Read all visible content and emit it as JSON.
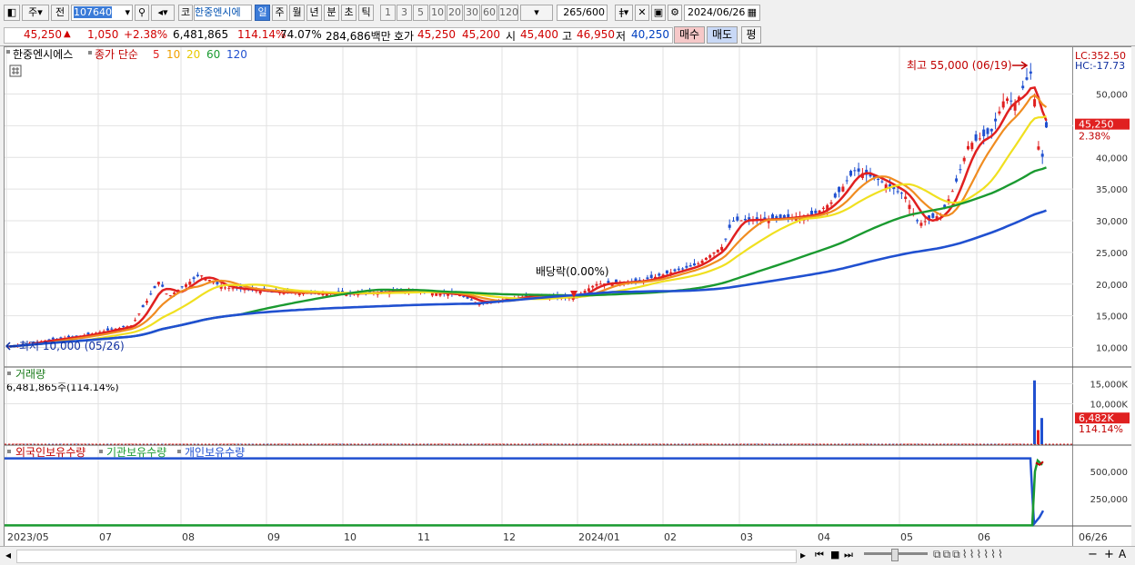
{
  "toolbar": {
    "period_letter": "주",
    "prev_label": "전",
    "code_value": "107640",
    "code_label": "코",
    "stock_name": "한중엔시에",
    "periods": [
      "일",
      "주",
      "월",
      "년",
      "분",
      "초",
      "틱"
    ],
    "selected_period": "일",
    "intervals": [
      "1",
      "3",
      "5",
      "10",
      "20",
      "30",
      "60",
      "120"
    ],
    "count_value": "265",
    "count_total": "/600",
    "date_value": "2024/06/26"
  },
  "quote": {
    "price": "45,250",
    "change_arrow": "▲",
    "change": "1,050",
    "change_pct": "+2.38%",
    "volume": "6,481,865",
    "volume_pct": "114.14%",
    "ratio": "74.07%",
    "amount": "284,686백만",
    "ask_label": "호가",
    "ask": "45,250",
    "bid": "45,200",
    "open_label": "시",
    "open": "45,400",
    "high_label": "고",
    "high": "46,950",
    "low_label": "저",
    "low": "40,250",
    "buy_label": "매수",
    "sell_label": "매도",
    "eval_label": "평"
  },
  "price_panel": {
    "legend_name": "한중엔시에스",
    "legend_type": "종가 단순",
    "ma": [
      {
        "period": "5",
        "color": "#e02020"
      },
      {
        "period": "10",
        "color": "#f0a000"
      },
      {
        "period": "20",
        "color": "#e8c800"
      },
      {
        "period": "60",
        "color": "#1a9a30"
      },
      {
        "period": "120",
        "color": "#2050d0"
      }
    ],
    "max_label": "최고 55,000 (06/19)",
    "min_label": "최저 10,000 (05/26)",
    "dividend_label": "배당락(0.00%)",
    "lc_label": "LC:352.50",
    "hc_label": "HC:-17.73",
    "current_price": "45,250",
    "current_pct": "2.38%",
    "yticks": [
      "50,000",
      "45,000",
      "40,000",
      "35,000",
      "30,000",
      "25,000",
      "20,000",
      "15,000",
      "10,000"
    ]
  },
  "volume_panel": {
    "title": "거래량",
    "value": "6,481,865주(114.14%)",
    "yticks": [
      "15,000K",
      "10,000K"
    ],
    "current": "6,482K",
    "current_pct": "114.14%"
  },
  "holding_panel": {
    "s1": "외국인보유수량",
    "s2": "기관보유수량",
    "s3": "개인보유수량",
    "yticks": [
      "500,000",
      "250,000"
    ]
  },
  "xaxis": {
    "labels": [
      "2023/05",
      "07",
      "08",
      "09",
      "10",
      "11",
      "12",
      "2024/01",
      "02",
      "03",
      "04",
      "05",
      "06"
    ],
    "end_label": "06/26"
  },
  "chart_data": {
    "type": "candlestick",
    "title": "한중엔시에스",
    "x_range": [
      "2023/05/26",
      "2024/06/26"
    ],
    "ylim": [
      8000,
      56000
    ],
    "monthly_close_approx": [
      {
        "x": "2023/05",
        "y": 10500
      },
      {
        "x": "2023/06",
        "y": 11800
      },
      {
        "x": "2023/07",
        "y": 12500
      },
      {
        "x": "2023/08",
        "y": 20000
      },
      {
        "x": "2023/09",
        "y": 18700
      },
      {
        "x": "2023/10",
        "y": 18300
      },
      {
        "x": "2023/11",
        "y": 18500
      },
      {
        "x": "2023/12",
        "y": 17800
      },
      {
        "x": "2024/01",
        "y": 20500
      },
      {
        "x": "2024/02",
        "y": 22000
      },
      {
        "x": "2024/03",
        "y": 30500
      },
      {
        "x": "2024/04",
        "y": 35000
      },
      {
        "x": "2024/05",
        "y": 30500
      },
      {
        "x": "2024/06",
        "y": 45250
      }
    ],
    "high": {
      "value": 55000,
      "date": "06/19"
    },
    "low": {
      "value": 10000,
      "date": "05/26"
    }
  }
}
